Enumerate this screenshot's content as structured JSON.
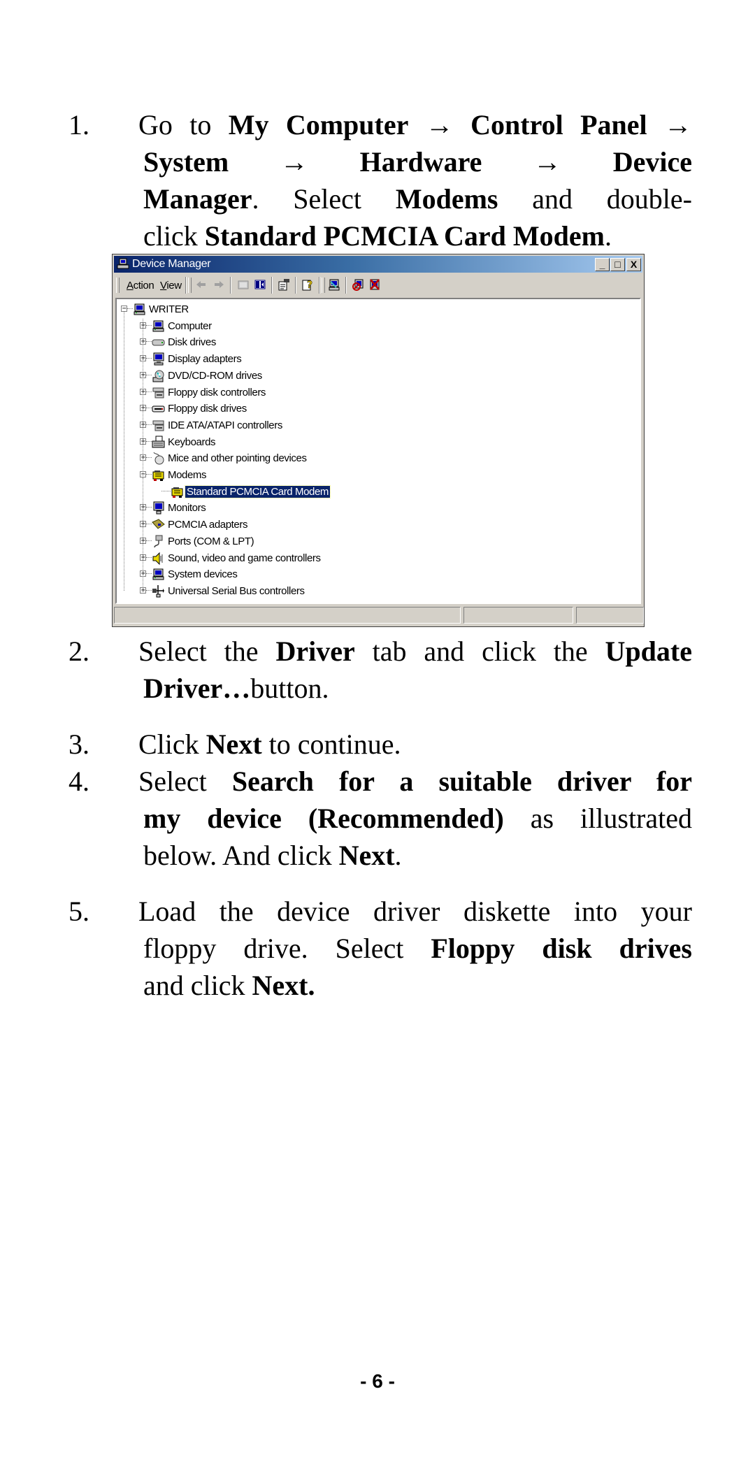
{
  "steps": [
    {
      "number": "1.",
      "lines": [
        [
          {
            "t": "Go to ",
            "b": false
          },
          {
            "t": "My Computer",
            "b": true
          },
          {
            "t": " → ",
            "b": false
          },
          {
            "t": "Control Panel",
            "b": true
          },
          {
            "t": " →",
            "b": false
          }
        ],
        [
          {
            "t": "System",
            "b": true
          },
          {
            "t": " → ",
            "b": false
          },
          {
            "t": "Hardware",
            "b": true
          },
          {
            "t": " → ",
            "b": false
          },
          {
            "t": "Device",
            "b": true
          }
        ],
        [
          {
            "t": "Manager",
            "b": true
          },
          {
            "t": ". Select ",
            "b": false
          },
          {
            "t": "Modems",
            "b": true
          },
          {
            "t": " and double-",
            "b": false
          }
        ],
        [
          {
            "t": "click ",
            "b": false
          },
          {
            "t": "Standard PCMCIA Card Modem",
            "b": true
          },
          {
            "t": ".",
            "b": false
          }
        ]
      ]
    },
    {
      "number": "2.",
      "lines": [
        [
          {
            "t": "Select the ",
            "b": false
          },
          {
            "t": "Driver",
            "b": true
          },
          {
            "t": " tab and click the ",
            "b": false
          },
          {
            "t": "Update",
            "b": true
          }
        ],
        [
          {
            "t": "Driver…",
            "b": true
          },
          {
            "t": "button.",
            "b": false
          }
        ]
      ]
    },
    {
      "number": "3.",
      "lines": [
        [
          {
            "t": "Click ",
            "b": false
          },
          {
            "t": "Next",
            "b": true
          },
          {
            "t": " to continue.",
            "b": false
          }
        ]
      ]
    },
    {
      "number": "4.",
      "lines": [
        [
          {
            "t": "Select ",
            "b": false
          },
          {
            "t": "Search for a suitable driver for",
            "b": true
          }
        ],
        [
          {
            "t": "my device (Recommended)",
            "b": true
          },
          {
            "t": " as illustrated",
            "b": false
          }
        ],
        [
          {
            "t": "below. And click ",
            "b": false
          },
          {
            "t": "Next",
            "b": true
          },
          {
            "t": ".",
            "b": false
          }
        ]
      ]
    },
    {
      "number": "5.",
      "lines": [
        [
          {
            "t": "Load the device driver diskette into your",
            "b": false
          }
        ],
        [
          {
            "t": "floppy drive. Select ",
            "b": false
          },
          {
            "t": "Floppy disk drives",
            "b": true
          }
        ],
        [
          {
            "t": "and click ",
            "b": false
          },
          {
            "t": "Next.",
            "b": true
          }
        ]
      ]
    }
  ],
  "device_manager": {
    "title": "Device Manager",
    "window_buttons": {
      "minimize": "_",
      "maximize": "□",
      "close": "X"
    },
    "menu": [
      {
        "label": "Action",
        "accel": "A"
      },
      {
        "label": "View",
        "accel": "V"
      }
    ],
    "toolbar_icons": [
      "back-arrow-icon",
      "forward-arrow-icon",
      "up-folder-icon",
      "show-hide-tree-icon",
      "properties-icon",
      "help-icon",
      "scan-hardware-icon",
      "disable-device-icon",
      "uninstall-device-icon"
    ],
    "root": {
      "label": "WRITER",
      "expanded": true,
      "icon": "computer-icon"
    },
    "items": [
      {
        "label": "Computer",
        "icon": "computer-icon",
        "expanded": false
      },
      {
        "label": "Disk drives",
        "icon": "disk-drive-icon",
        "expanded": false
      },
      {
        "label": "Display adapters",
        "icon": "display-adapter-icon",
        "expanded": false
      },
      {
        "label": "DVD/CD-ROM drives",
        "icon": "cdrom-icon",
        "expanded": false
      },
      {
        "label": "Floppy disk controllers",
        "icon": "controller-icon",
        "expanded": false
      },
      {
        "label": "Floppy disk drives",
        "icon": "floppy-drive-icon",
        "expanded": false
      },
      {
        "label": "IDE ATA/ATAPI controllers",
        "icon": "controller-icon",
        "expanded": false
      },
      {
        "label": "Keyboards",
        "icon": "keyboard-icon",
        "expanded": false
      },
      {
        "label": "Mice and other pointing devices",
        "icon": "mouse-icon",
        "expanded": false
      },
      {
        "label": "Modems",
        "icon": "modem-icon",
        "expanded": true,
        "children": [
          {
            "label": "Standard PCMCIA Card Modem",
            "icon": "modem-icon",
            "selected": true
          }
        ]
      },
      {
        "label": "Monitors",
        "icon": "monitor-icon",
        "expanded": false
      },
      {
        "label": "PCMCIA adapters",
        "icon": "pcmcia-icon",
        "expanded": false
      },
      {
        "label": "Ports (COM & LPT)",
        "icon": "port-icon",
        "expanded": false
      },
      {
        "label": "Sound, video and game controllers",
        "icon": "sound-icon",
        "expanded": false
      },
      {
        "label": "System devices",
        "icon": "computer-icon",
        "expanded": false
      },
      {
        "label": "Universal Serial Bus controllers",
        "icon": "usb-icon",
        "expanded": false
      }
    ],
    "colors": {
      "title_gradient_start": "#0a246a",
      "title_gradient_end": "#a6caf0",
      "face": "#d4d0c8",
      "selection": "#0a246a"
    }
  },
  "page_number": "- 6 -"
}
